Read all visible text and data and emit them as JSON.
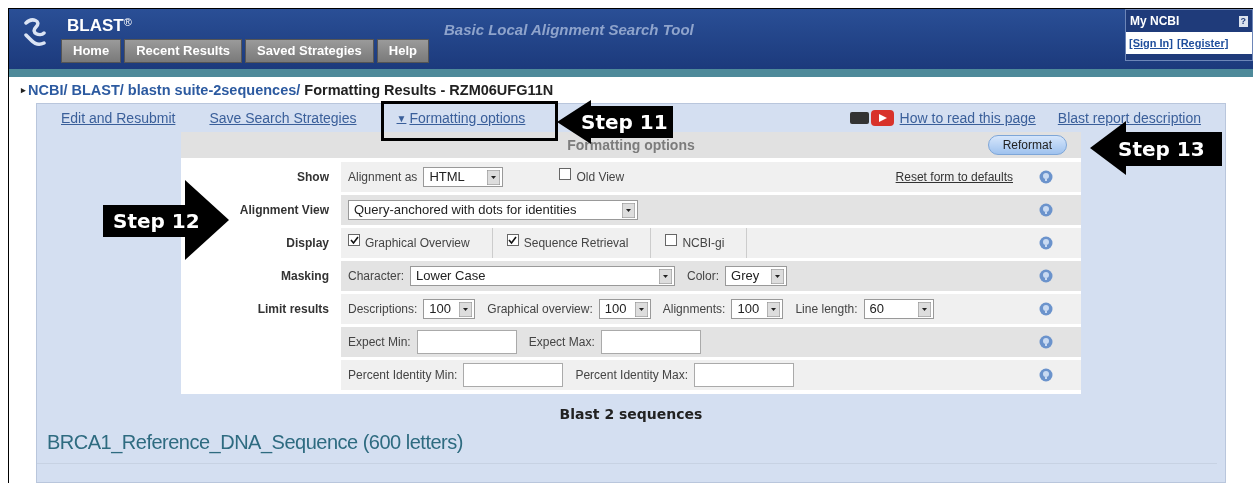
{
  "header": {
    "logo": "BLAST",
    "logo_mark": "®",
    "title": "Basic Local Alignment Search Tool",
    "tabs": [
      "Home",
      "Recent Results",
      "Saved Strategies",
      "Help"
    ],
    "my_ncbi": {
      "title": "My NCBI",
      "help": "?",
      "links": [
        "[Sign In]",
        "[Register]"
      ]
    }
  },
  "breadcrumb": {
    "marker": "▸",
    "links": [
      "NCBI/",
      "BLAST/",
      "blastn suite-2sequences/"
    ],
    "current": "Formatting Results - RZM06UFG11N"
  },
  "toolbar": {
    "links": [
      "Edit and Resubmit",
      "Save Search Strategies"
    ],
    "toggle": {
      "icon": "▼",
      "text": "Formatting options"
    },
    "help_links": [
      "How to read this page",
      "Blast report description"
    ]
  },
  "form": {
    "title": "Formatting options",
    "reformat_button": "Reformat",
    "rows": [
      {
        "label": "Show",
        "controls": [
          {
            "kind": "label",
            "text": "Alignment as"
          },
          {
            "kind": "select",
            "value": "HTML"
          },
          {
            "kind": "checkbox",
            "text": "Old View",
            "checked": false
          },
          {
            "kind": "link",
            "text": "Reset form to defaults"
          }
        ]
      },
      {
        "label": "Alignment View",
        "controls": [
          {
            "kind": "select",
            "value": "Query-anchored with dots for identities"
          }
        ]
      },
      {
        "label": "Display",
        "controls": [
          {
            "kind": "checkbox",
            "text": "Graphical Overview",
            "checked": true
          },
          {
            "kind": "checkbox",
            "text": "Sequence Retrieval",
            "checked": true
          },
          {
            "kind": "checkbox",
            "text": "NCBI-gi",
            "checked": false
          }
        ]
      },
      {
        "label": "Masking",
        "controls": [
          {
            "kind": "label",
            "text": "Character:"
          },
          {
            "kind": "select",
            "value": "Lower Case"
          },
          {
            "kind": "label",
            "text": "Color:"
          },
          {
            "kind": "select",
            "value": "Grey"
          }
        ]
      },
      {
        "label": "Limit results",
        "controls": [
          {
            "kind": "label",
            "text": "Descriptions:"
          },
          {
            "kind": "select",
            "value": "100"
          },
          {
            "kind": "label",
            "text": "Graphical overview:"
          },
          {
            "kind": "select",
            "value": "100"
          },
          {
            "kind": "label",
            "text": "Alignments:"
          },
          {
            "kind": "select",
            "value": "100"
          },
          {
            "kind": "label",
            "text": "Line length:"
          },
          {
            "kind": "select",
            "value": "60"
          }
        ]
      },
      {
        "controls": [
          {
            "kind": "label",
            "text": "Expect Min:"
          },
          {
            "kind": "input"
          },
          {
            "kind": "label",
            "text": "Expect Max:"
          },
          {
            "kind": "input"
          }
        ]
      },
      {
        "controls": [
          {
            "kind": "label",
            "text": "Percent Identity Min:"
          },
          {
            "kind": "input"
          },
          {
            "kind": "label",
            "text": "Percent Identity Max:"
          },
          {
            "kind": "input"
          }
        ]
      }
    ]
  },
  "results": {
    "program": "Blast 2 sequences",
    "query_title": "BRCA1_Reference_DNA_Sequence (600 letters)"
  },
  "annotations": [
    "Step 11",
    "Step 12",
    "Step 13"
  ]
}
